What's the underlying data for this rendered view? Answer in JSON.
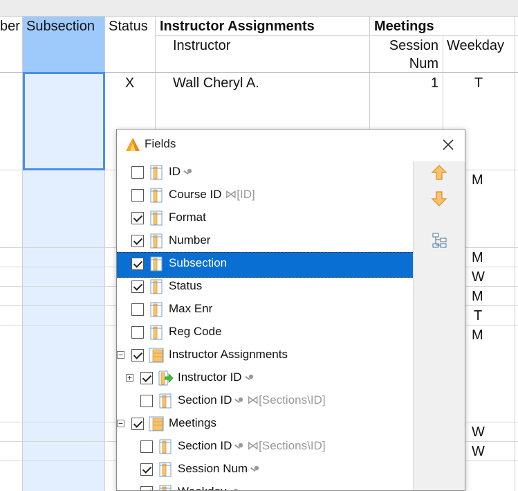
{
  "grid": {
    "headers": {
      "number_partial": "ber",
      "subsection": "Subsection",
      "status": "Status",
      "instructor_assignments": "Instructor Assignments",
      "meetings": "Meetings",
      "instructor": "Instructor",
      "session_num_line1": "Session",
      "session_num_line2": "Num",
      "weekday": "Weekday"
    },
    "row1": {
      "status": "X",
      "instructor": "Wall Cheryl A.",
      "session_num": "1",
      "weekday": "T"
    },
    "weekdays": [
      "M",
      "M",
      "W",
      "M",
      "T",
      "M",
      "W",
      "W"
    ]
  },
  "dialog": {
    "title": "Fields",
    "items": [
      {
        "label": "ID",
        "checked": false,
        "key": true,
        "ref": ""
      },
      {
        "label": "Course ID",
        "checked": false,
        "key": false,
        "ref": "[ID]"
      },
      {
        "label": "Format",
        "checked": true,
        "key": false,
        "ref": ""
      },
      {
        "label": "Number",
        "checked": true,
        "key": false,
        "ref": ""
      },
      {
        "label": "Subsection",
        "checked": true,
        "key": false,
        "ref": "",
        "selected": true
      },
      {
        "label": "Status",
        "checked": true,
        "key": false,
        "ref": ""
      },
      {
        "label": "Max Enr",
        "checked": false,
        "key": false,
        "ref": ""
      },
      {
        "label": "Reg Code",
        "checked": false,
        "key": false,
        "ref": ""
      },
      {
        "label": "Instructor Assignments",
        "checked": true,
        "key": false,
        "ref": ""
      },
      {
        "label": "Instructor ID",
        "checked": true,
        "key": true,
        "ref": ""
      },
      {
        "label": "Section ID",
        "checked": false,
        "key": true,
        "ref": "[Sections\\ID]"
      },
      {
        "label": "Meetings",
        "checked": true,
        "key": false,
        "ref": ""
      },
      {
        "label": "Section ID",
        "checked": false,
        "key": true,
        "ref": "[Sections\\ID]"
      },
      {
        "label": "Session Num",
        "checked": true,
        "key": true,
        "ref": ""
      },
      {
        "label": "Weekday",
        "checked": true,
        "key": true,
        "ref": ""
      }
    ]
  },
  "colors": {
    "accent": "#0a6fd3",
    "selected_column": "#9ec9fb",
    "arrow": "#f5a623"
  }
}
